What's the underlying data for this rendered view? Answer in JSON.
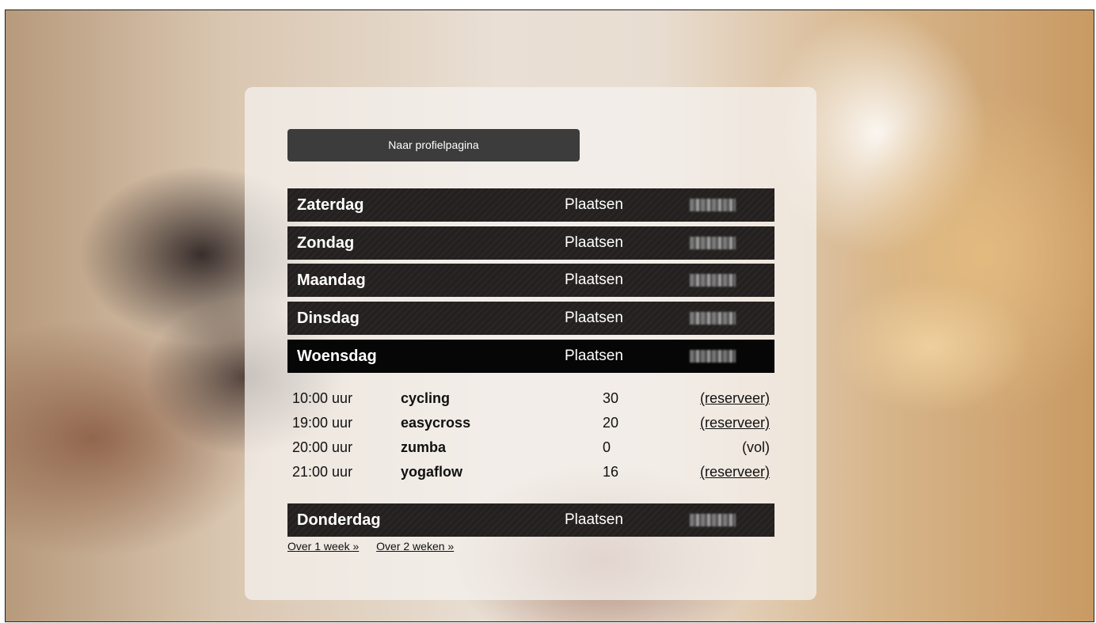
{
  "profile_button": {
    "label": "Naar profielpagina"
  },
  "days": [
    {
      "name": "Zaterdag",
      "places_label": "Plaatsen"
    },
    {
      "name": "Zondag",
      "places_label": "Plaatsen"
    },
    {
      "name": "Maandag",
      "places_label": "Plaatsen"
    },
    {
      "name": "Dinsdag",
      "places_label": "Plaatsen"
    },
    {
      "name": "Woensdag",
      "places_label": "Plaatsen"
    },
    {
      "name": "Donderdag",
      "places_label": "Plaatsen"
    }
  ],
  "lessons": [
    {
      "time": "10:00 uur",
      "name": "cycling",
      "places": "30",
      "action": "(reserveer)"
    },
    {
      "time": "19:00 uur",
      "name": "easycross",
      "places": "20",
      "action": "(reserveer)"
    },
    {
      "time": "20:00 uur",
      "name": "zumba",
      "places": "0",
      "action": "(vol)"
    },
    {
      "time": "21:00 uur",
      "name": "yogaflow",
      "places": "16",
      "action": "(reserveer)"
    }
  ],
  "week_links": {
    "one_week": "Over 1 week »",
    "two_weeks": "Over 2 weken »"
  },
  "colors": {
    "day_row": "#242020",
    "day_row_active": "#060606",
    "button": "#3c3c3c"
  }
}
